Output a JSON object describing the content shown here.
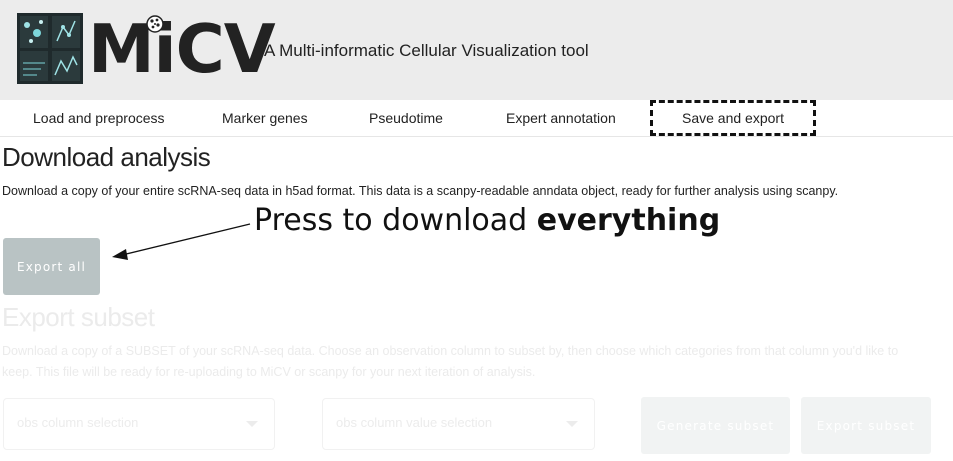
{
  "app": {
    "logo_letters": "MiCV",
    "subtitle": "A Multi-informatic Cellular Visualization tool"
  },
  "nav": {
    "tabs": [
      {
        "label": "Load and preprocess",
        "active": false
      },
      {
        "label": "Marker genes",
        "active": false
      },
      {
        "label": "Pseudotime",
        "active": false
      },
      {
        "label": "Expert annotation",
        "active": false
      },
      {
        "label": "Save and export",
        "active": true
      }
    ]
  },
  "download": {
    "heading": "Download analysis",
    "description": "Download a copy of your entire scRNA-seq data in h5ad format. This data is a scanpy-readable anndata object, ready for further analysis using scanpy.",
    "button_label": "Export all"
  },
  "annotation": {
    "text_prefix": "Press to download ",
    "text_bold": "everything"
  },
  "subset": {
    "heading": "Export subset",
    "description": "Download a copy of a SUBSET of your scRNA-seq data. Choose an observation column to subset by, then choose which categories from that column you'd like to keep. This file will be ready for re-uploading to MiCV or scanpy for your next iteration of analysis.",
    "column_select_placeholder": "obs column selection",
    "value_select_placeholder": "obs column value selection",
    "generate_button_label": "Generate subset",
    "export_button_label": "Export subset"
  },
  "colors": {
    "header_bg": "#ececec",
    "button_bg": "#b9c3c4",
    "faded_text": "#ebebeb"
  }
}
